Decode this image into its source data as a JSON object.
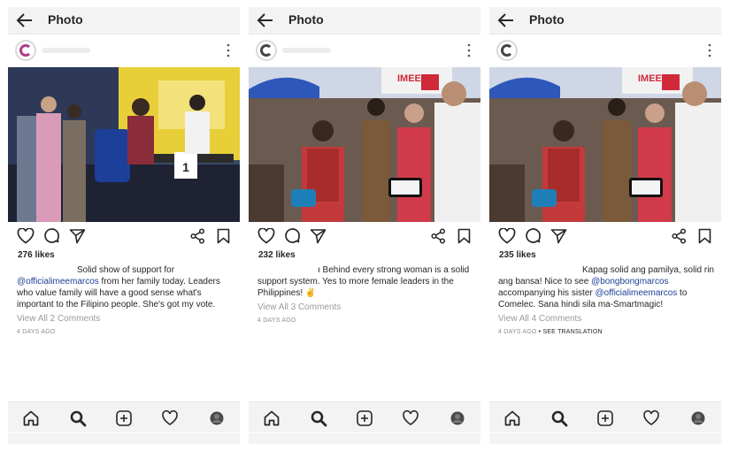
{
  "header": {
    "title": "Photo"
  },
  "posts": [
    {
      "likes": "276 likes",
      "caption_parts": [
        "Solid show of support for ",
        "@officialimeemarcos",
        " from her family today. Leaders who value family will have a good sense what's important to the Filipino people. She's got my vote."
      ],
      "view_all": "View All 2 Comments",
      "time": "4 DAYS AGO",
      "translation": ""
    },
    {
      "likes": "232 likes",
      "caption_parts": [
        "ı Behind every strong woman is a solid support system. Yes to more female leaders in the Philippines! ✌️"
      ],
      "view_all": "View All 3 Comments",
      "time": "4 DAYS AGO",
      "translation": ""
    },
    {
      "likes": "235 likes",
      "caption_parts": [
        "Kapag solid ang pamilya, solid rin ang bansa! Nice to see ",
        "@bongbongmarcos",
        " accompanying his sister ",
        "@officialimeemarcos",
        " to Comelec. Sana hindi sila ma-Smartmagic!"
      ],
      "view_all": "View All 4 Comments",
      "time": "4 DAYS AGO",
      "translation": " • SEE TRANSLATION"
    }
  ],
  "photo1": {
    "number_card": "1"
  },
  "photo_banner": {
    "text": "IMEE"
  },
  "colors": {
    "mention": "#1c3f94",
    "muted": "#9a9a9a",
    "bar_bg": "#f3f3f3",
    "avatar_ring": "#b23a8c"
  },
  "icons": {
    "top": [
      "back-arrow-icon",
      "more-vertical-icon"
    ],
    "actions": [
      "heart-icon",
      "comment-icon",
      "send-icon",
      "share-icon",
      "bookmark-icon"
    ],
    "nav": [
      "home-icon",
      "search-icon",
      "add-post-icon",
      "activity-heart-icon",
      "profile-icon"
    ]
  }
}
